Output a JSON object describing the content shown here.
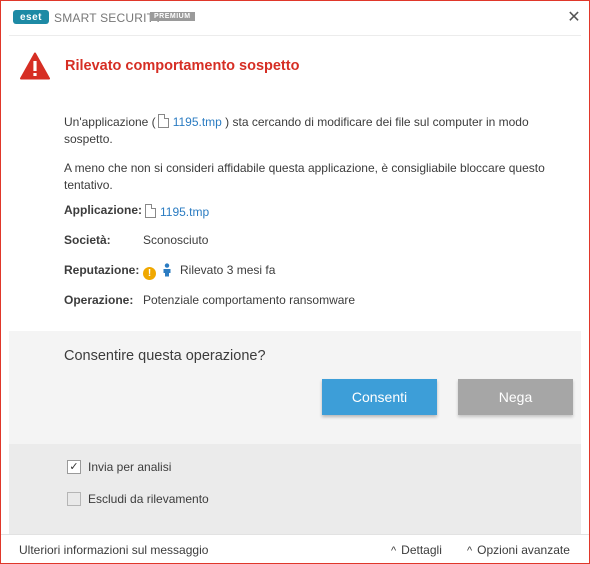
{
  "titlebar": {
    "logo_text": "eset",
    "app_name": "SMART SECURITY",
    "edition_badge": "PREMIUM",
    "close_icon": "close-icon",
    "close_glyph": "✕"
  },
  "alert": {
    "icon": "warning-triangle-icon",
    "title": "Rilevato comportamento sospetto",
    "title_color": "#d62e24",
    "desc1_prefix": "Un'applicazione (",
    "desc1_file": "1195.tmp",
    "desc1_suffix_line1": " ) sta cercando di modificare dei file sul computer in modo",
    "desc1_suffix_line2": "sospetto.",
    "desc2_line1": "A meno che non si consideri affidabile questa applicazione, è consigliabile bloccare questo",
    "desc2_line2": "tentativo."
  },
  "details": {
    "application_label": "Applicazione:",
    "application_value": "1195.tmp",
    "company_label": "Società:",
    "company_value": "Sconosciuto",
    "reputation_label": "Reputazione:",
    "reputation_warn_glyph": "!",
    "reputation_value": "Rilevato 3 mesi fa",
    "operation_label": "Operazione:",
    "operation_value": "Potenziale comportamento ransomware"
  },
  "decision": {
    "question": "Consentire questa operazione?",
    "allow_label": "Consenti",
    "deny_label": "Nega",
    "allow_color": "#3d9ed8",
    "deny_color": "#a6a6a6"
  },
  "options": {
    "submit_label": "Invia per analisi",
    "submit_checked": true,
    "submit_check_glyph": "✓",
    "exclude_label": "Escludi da rilevamento",
    "exclude_checked": false
  },
  "footer": {
    "more_info": "Ulteriori informazioni sul messaggio",
    "details": "Dettagli",
    "advanced": "Opzioni avanzate",
    "chevron_glyph": "^",
    "chevron_icon": "chevron-up-icon"
  }
}
